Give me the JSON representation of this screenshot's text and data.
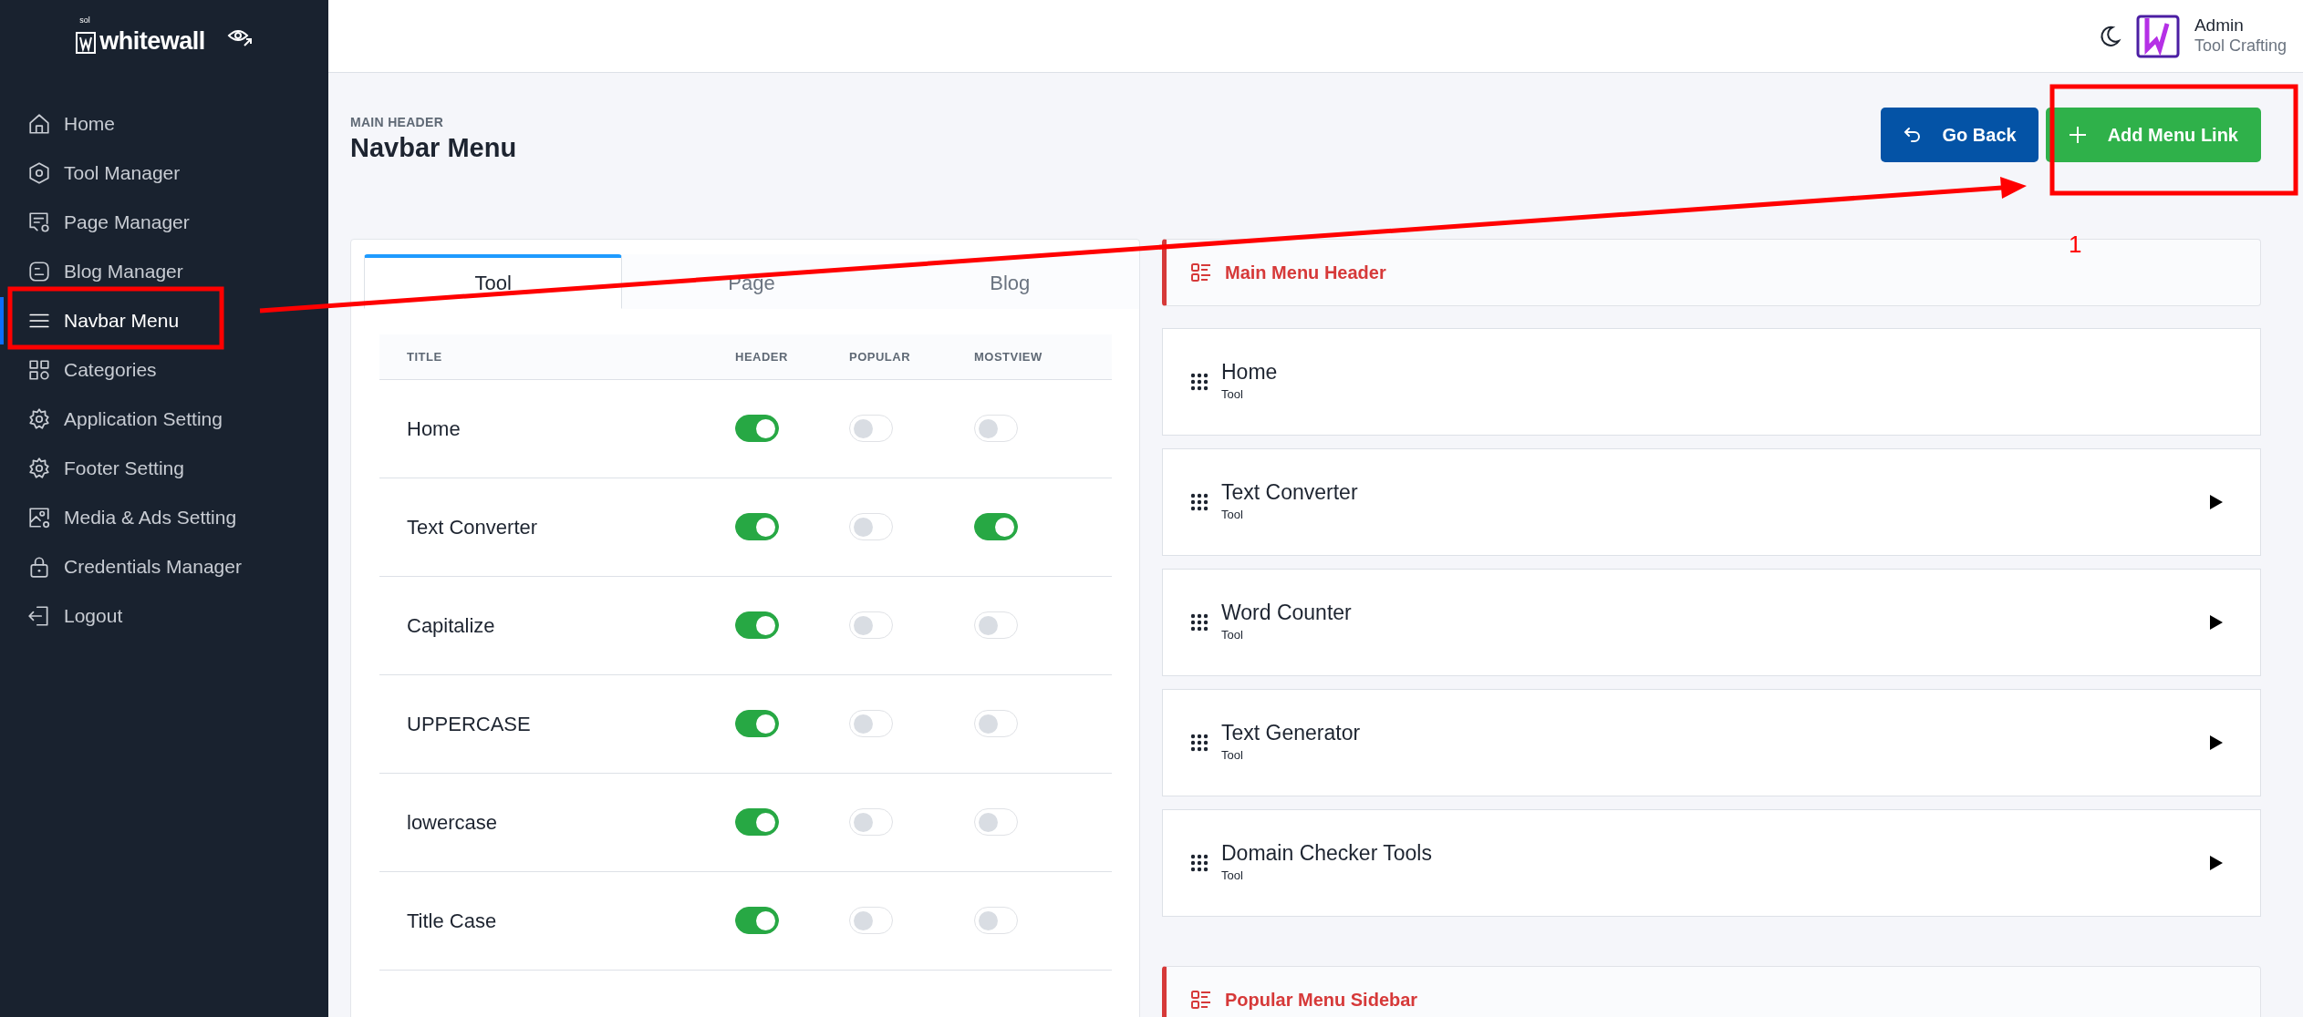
{
  "sidebar": {
    "logo": {
      "superscript": "sol",
      "text": "whitewall"
    },
    "items": [
      {
        "label": "Home",
        "selected": false
      },
      {
        "label": "Tool Manager",
        "selected": false
      },
      {
        "label": "Page Manager",
        "selected": false
      },
      {
        "label": "Blog Manager",
        "selected": false
      },
      {
        "label": "Navbar Menu",
        "selected": true
      },
      {
        "label": "Categories",
        "selected": false
      },
      {
        "label": "Application Setting",
        "selected": false
      },
      {
        "label": "Footer Setting",
        "selected": false
      },
      {
        "label": "Media & Ads Setting",
        "selected": false
      },
      {
        "label": "Credentials Manager",
        "selected": false
      },
      {
        "label": "Logout",
        "selected": false
      }
    ]
  },
  "topbar": {
    "user_name": "Admin",
    "user_role": "Tool Crafting"
  },
  "page_header": {
    "eyebrow": "MAIN HEADER",
    "title": "Navbar Menu",
    "buttons": [
      {
        "label": "Go Back",
        "kind": "back"
      },
      {
        "label": "Add Menu Link",
        "kind": "add"
      }
    ]
  },
  "tabs": [
    {
      "label": "Tool",
      "selected": true
    },
    {
      "label": "Page",
      "selected": false
    },
    {
      "label": "Blog",
      "selected": false
    }
  ],
  "table": {
    "columns": [
      "TITLE",
      "HEADER",
      "POPULAR",
      "MOSTVIEW"
    ],
    "rows": [
      {
        "title": "Home",
        "header": true,
        "popular": false,
        "mostview": false
      },
      {
        "title": "Text Converter",
        "header": true,
        "popular": false,
        "mostview": true
      },
      {
        "title": "Capitalize",
        "header": true,
        "popular": false,
        "mostview": false
      },
      {
        "title": "UPPERCASE",
        "header": true,
        "popular": false,
        "mostview": false
      },
      {
        "title": "lowercase",
        "header": true,
        "popular": false,
        "mostview": false
      },
      {
        "title": "Title Case",
        "header": true,
        "popular": false,
        "mostview": false
      }
    ]
  },
  "menu_sections": [
    {
      "title": "Main Menu Header",
      "items": [
        {
          "title": "Home",
          "type": "Tool",
          "has_children": false
        },
        {
          "title": "Text Converter",
          "type": "Tool",
          "has_children": true
        },
        {
          "title": "Word Counter",
          "type": "Tool",
          "has_children": true
        },
        {
          "title": "Text Generator",
          "type": "Tool",
          "has_children": true
        },
        {
          "title": "Domain Checker Tools",
          "type": "Tool",
          "has_children": true
        }
      ]
    },
    {
      "title": "Popular Menu Sidebar"
    }
  ],
  "annotations": {
    "label": "1"
  }
}
